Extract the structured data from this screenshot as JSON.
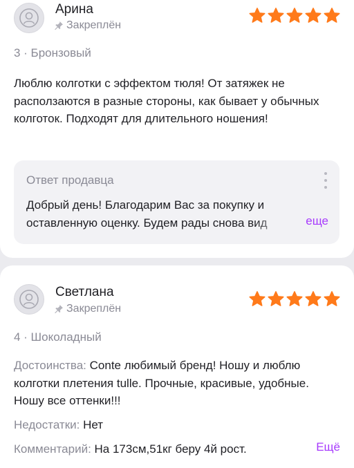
{
  "review1": {
    "author": "Арина",
    "pinned": "Закреплён",
    "rating": 5,
    "variant": "3 · Бронзовый",
    "text": "Люблю колготки с эффектом тюля! От затяжек не расползаются в разные стороны, как бывает у обычных колготок. Подходят для длительного ношения!",
    "reply": {
      "title": "Ответ продавца",
      "text": "Добрый день! Благодарим Вас за покупку и оставленную оценку. Будем рады снова вид",
      "more": "еще"
    }
  },
  "review2": {
    "author": "Светлана",
    "pinned": "Закреплён",
    "rating": 5,
    "variant": "4 · Шоколадный",
    "pros_label": "Достоинства:",
    "pros_text": " Conte любимый бренд! Ношу и люблю колготки плетения tulle. Прочные, красивые, удобные. Ношу все оттенки!!!",
    "cons_label": "Недостатки:",
    "cons_text": " Нет",
    "comment_label": "Комментарий:",
    "comment_text": " На 173см,51кг беру 4й рост.",
    "more": "Ещё"
  },
  "colors": {
    "star": "#ff7a1a",
    "accent": "#a73afd",
    "muted": "#8a8a95"
  },
  "icons": [
    "user-avatar-icon",
    "pin-icon",
    "star-icon",
    "kebab-menu-icon"
  ]
}
